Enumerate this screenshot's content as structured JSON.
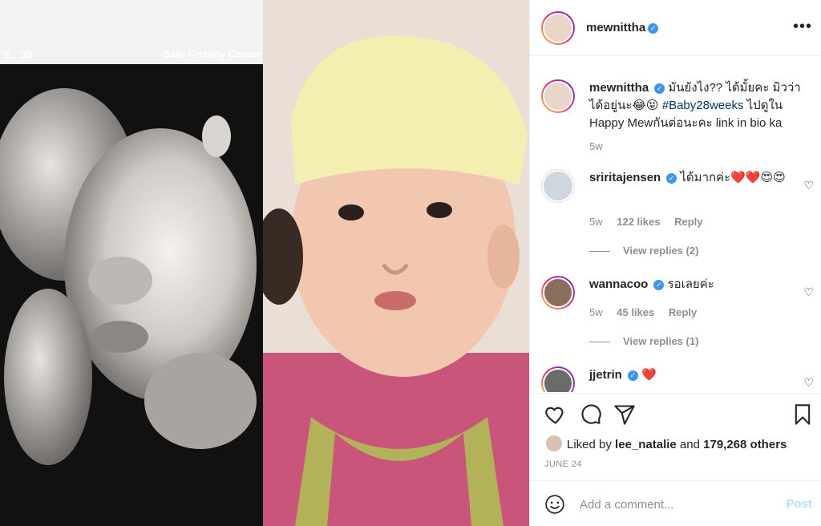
{
  "media": {
    "scan_label_left": "S.,  30",
    "scan_label_right": "Safe Fertility Center"
  },
  "header": {
    "username": "mewnittha",
    "more_icon": "more-horizontal-icon"
  },
  "caption": {
    "username": "mewnittha",
    "text_before": "มันยังไง?? ได้มั้ยคะ มิวว่าได้อยู่นะ😂😝 ",
    "hashtag": "#Baby28weeks",
    "text_after": " ไปดูใน Happy Mewกันต่อนะคะ link in bio ka",
    "time": "5w"
  },
  "comments": [
    {
      "username": "sriritajensen",
      "text": "ได้มากค่ะ❤️❤️😍😍",
      "time": "5w",
      "likes": "122 likes",
      "reply": "Reply",
      "view_replies": "View replies (2)"
    },
    {
      "username": "wannacoo",
      "text": "รอเลยค่ะ",
      "time": "5w",
      "likes": "45 likes",
      "reply": "Reply",
      "view_replies": "View replies (1)"
    },
    {
      "username": "jjetrin",
      "text": "❤️"
    }
  ],
  "actions": {
    "liked_by_prefix": "Liked by ",
    "liked_by_user": "lee_natalie",
    "liked_by_mid": " and ",
    "liked_by_count": "179,268 others",
    "date": "JUNE 24"
  },
  "composer": {
    "placeholder": "Add a comment...",
    "post_label": "Post"
  },
  "colors": {
    "verified": "#3897f0",
    "hashtag": "#00376b",
    "post_disabled": "#b2dffc"
  }
}
